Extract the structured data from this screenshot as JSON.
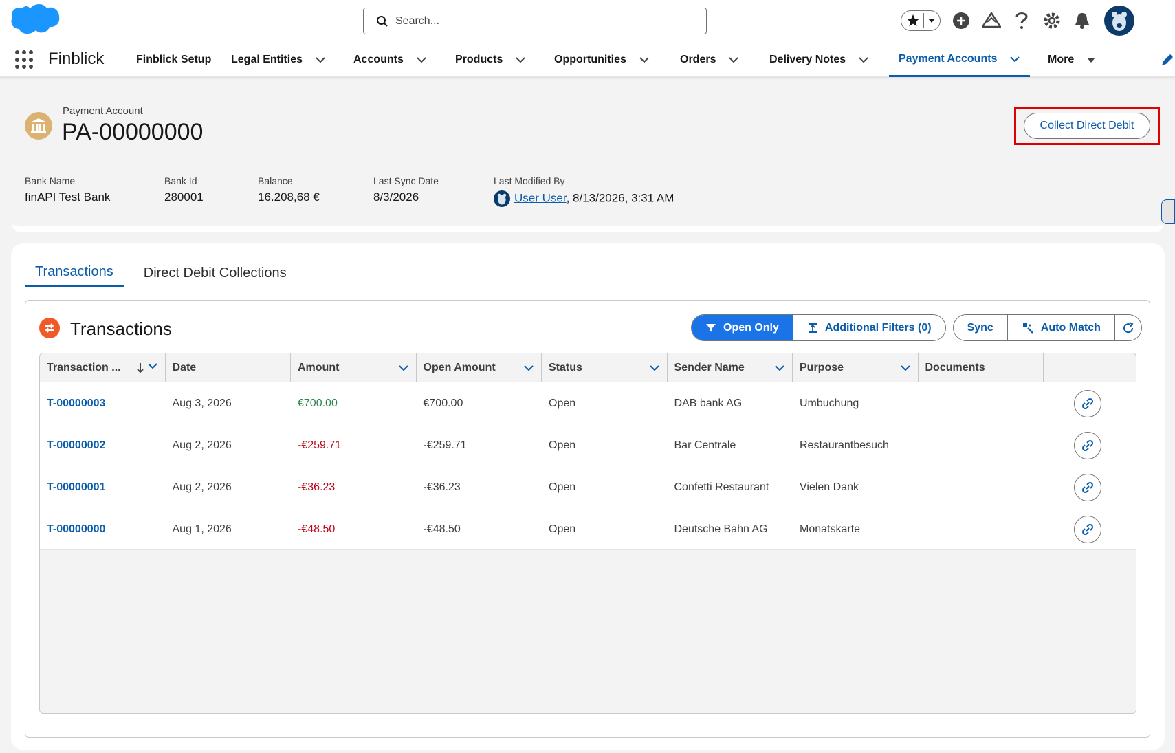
{
  "header": {
    "search_placeholder": "Search..."
  },
  "nav": {
    "app_name": "Finblick",
    "items": [
      {
        "label": "Finblick Setup"
      },
      {
        "label": "Legal Entities"
      },
      {
        "label": "Accounts"
      },
      {
        "label": "Products"
      },
      {
        "label": "Opportunities"
      },
      {
        "label": "Orders"
      },
      {
        "label": "Delivery Notes"
      },
      {
        "label": "Payment Accounts"
      },
      {
        "label": "More"
      }
    ]
  },
  "record": {
    "type": "Payment Account",
    "title": "PA-00000000",
    "action_button": "Collect Direct Debit",
    "fields": [
      {
        "label": "Bank Name",
        "value": "finAPI Test Bank"
      },
      {
        "label": "Bank Id",
        "value": "280001"
      },
      {
        "label": "Balance",
        "value": "16.208,68 €"
      },
      {
        "label": "Last Sync Date",
        "value": "8/3/2026"
      },
      {
        "label": "Last Modified By",
        "user": "User User",
        "value": ", 8/13/2026, 3:31 AM"
      }
    ]
  },
  "tabs": [
    {
      "label": "Transactions"
    },
    {
      "label": "Direct Debit Collections"
    }
  ],
  "transactions": {
    "title": "Transactions",
    "toolbar": {
      "open_only": "Open Only",
      "additional_filters": "Additional Filters (0)",
      "sync": "Sync",
      "auto_match": "Auto Match"
    },
    "columns": [
      "Transaction ...",
      "Date",
      "Amount",
      "Open Amount",
      "Status",
      "Sender Name",
      "Purpose",
      "Documents"
    ],
    "rows": [
      {
        "id": "T-00000003",
        "date": "Aug 3, 2026",
        "amount": "€700.00",
        "open_amount": "€700.00",
        "status": "Open",
        "sender": "DAB bank AG",
        "purpose": "Umbuchung",
        "documents": ""
      },
      {
        "id": "T-00000002",
        "date": "Aug 2, 2026",
        "amount": "-€259.71",
        "open_amount": "-€259.71",
        "status": "Open",
        "sender": "Bar Centrale",
        "purpose": "Restaurantbesuch",
        "documents": ""
      },
      {
        "id": "T-00000001",
        "date": "Aug 2, 2026",
        "amount": "-€36.23",
        "open_amount": "-€36.23",
        "status": "Open",
        "sender": "Confetti Restaurant",
        "purpose": "Vielen Dank",
        "documents": ""
      },
      {
        "id": "T-00000000",
        "date": "Aug 1, 2026",
        "amount": "-€48.50",
        "open_amount": "-€48.50",
        "status": "Open",
        "sender": "Deutsche Bahn AG",
        "purpose": "Monatskarte",
        "documents": ""
      }
    ]
  },
  "colors": {
    "brand_blue": "#0b5cab",
    "primary_button": "#1b73e8",
    "highlight_red": "#e00000",
    "positive_amount": "#2e844a",
    "negative_amount": "#ba0517"
  }
}
